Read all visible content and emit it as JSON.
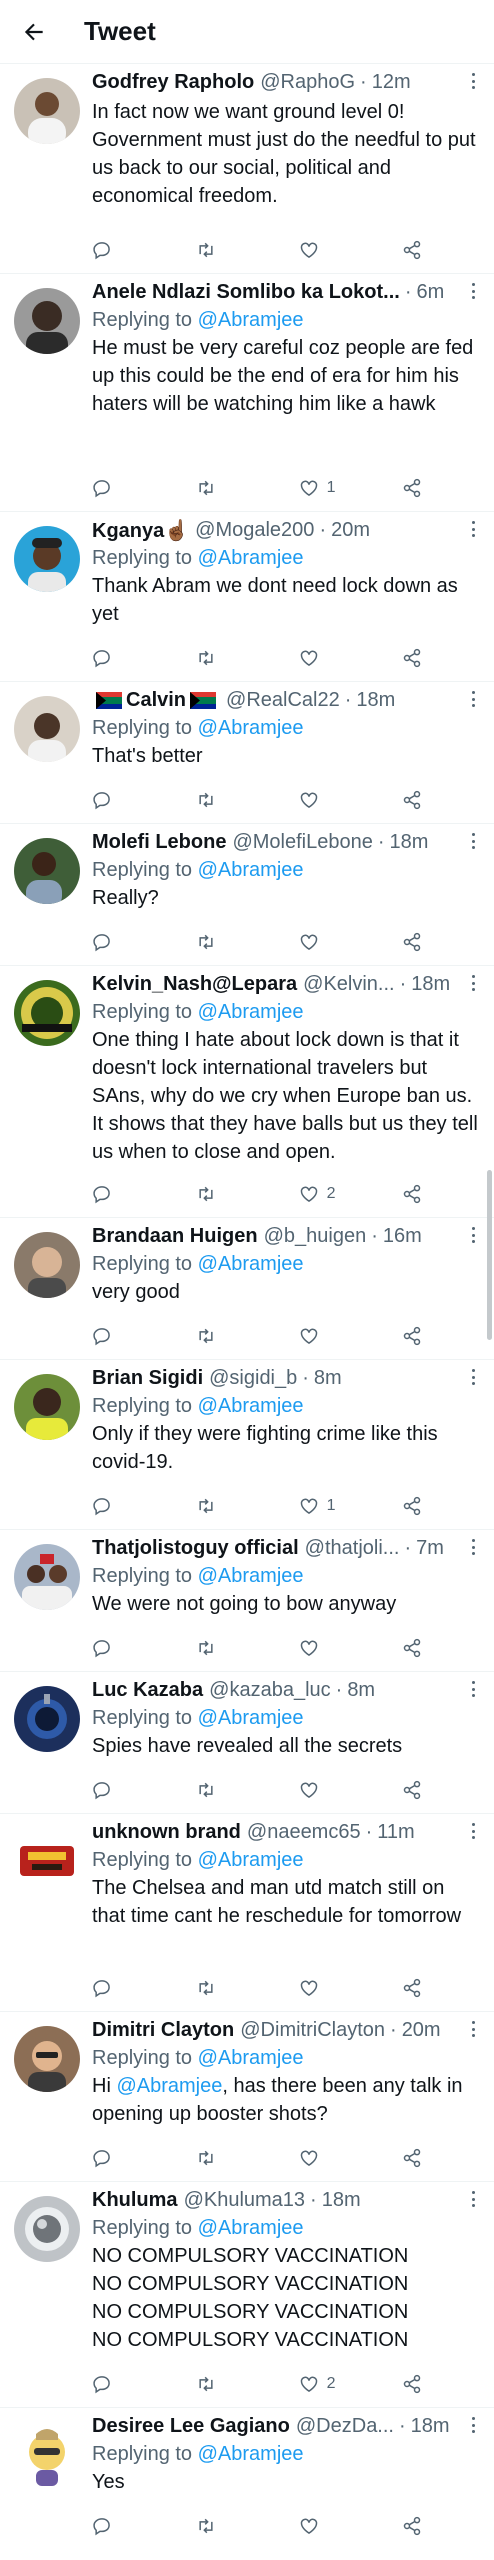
{
  "header": {
    "title": "Tweet"
  },
  "replying_label": "Replying to",
  "tweets": [
    {
      "name": "Godfrey Rapholo",
      "handle": "@RaphoG",
      "time": "12m",
      "replying_to": "@Abramjee",
      "text": "In fact now we want ground level 0! Government must just do the needful to put us back to our social, political and economical freedom.",
      "likes": "",
      "avatar_color": "#c9c1b6"
    },
    {
      "name": "Anele Ndlazi Somlibo ka Lokot...",
      "handle": "",
      "time": "6m",
      "replying_to": "@Abramjee",
      "text": "He must be very careful coz people are fed up this could be the end of era for him his haters will be watching him like a hawk",
      "likes": "1",
      "avatar_color": "#4a4a4a"
    },
    {
      "name": "Kganya☝🏾",
      "handle": "@Mogale200",
      "time": "20m",
      "replying_to": "@Abramjee",
      "text": "Thank Abram we dont need lock down as yet",
      "likes": "",
      "avatar_color": "#2aa3d8"
    },
    {
      "name": "Calvin",
      "handle": "@RealCal22",
      "time": "18m",
      "replying_to": "@Abramjee",
      "text": "That's better",
      "likes": "",
      "avatar_color": "#d9d2c8"
    },
    {
      "name": "Molefi Lebone",
      "handle": "@MolefiLebone",
      "time": "18m",
      "replying_to": "@Abramjee",
      "text": "Really?",
      "likes": "",
      "avatar_color": "#3f5e38"
    },
    {
      "name": "Kelvin_Nash@Lepara",
      "handle": "@Kelvin...",
      "time": "18m",
      "replying_to": "@Abramjee",
      "text": "One thing I hate about lock down is that it doesn't lock international travelers but SAns, why do we cry when Europe ban us. It shows that they have balls but us they tell us when to close and open.",
      "likes": "2",
      "avatar_color": "#3b6b1e"
    },
    {
      "name": "Brandaan Huigen",
      "handle": "@b_huigen",
      "time": "16m",
      "replying_to": "@Abramjee",
      "text": "very good",
      "likes": "",
      "avatar_color": "#8a7a6a"
    },
    {
      "name": "Brian Sigidi",
      "handle": "@sigidi_b",
      "time": "8m",
      "replying_to": "@Abramjee",
      "text": "Only if they were fighting crime like this covid-19.",
      "likes": "1",
      "avatar_color": "#6d8f3a"
    },
    {
      "name": "Thatjolistoguy official",
      "handle": "@thatjoli...",
      "time": "7m",
      "replying_to": "@Abramjee",
      "text": "We were not going to bow anyway",
      "likes": "",
      "avatar_color": "#a9b7c9"
    },
    {
      "name": "Luc Kazaba",
      "handle": "@kazaba_luc",
      "time": "8m",
      "replying_to": "@Abramjee",
      "text": "Spies have revealed all the secrets",
      "likes": "",
      "avatar_color": "#1c2f5c"
    },
    {
      "name": "unknown brand",
      "handle": "@naeemc65",
      "time": "11m",
      "replying_to": "@Abramjee",
      "text": "The Chelsea and man utd match still on that time cant he reschedule for tomorrow",
      "likes": "",
      "avatar_color": "#b8221c"
    },
    {
      "name": "Dimitri Clayton",
      "handle": "@DimitriClayton",
      "time": "20m",
      "replying_to": "@Abramjee",
      "text_pre": "Hi ",
      "text_mention": "@Abramjee",
      "text": ", has there been any talk in opening up booster shots?",
      "likes": "",
      "avatar_color": "#8c6e55"
    },
    {
      "name": "Khuluma",
      "handle": "@Khuluma13",
      "time": "18m",
      "replying_to": "@Abramjee",
      "text": "NO COMPULSORY VACCINATION NO COMPULSORY VACCINATION NO COMPULSORY VACCINATION NO COMPULSORY VACCINATION",
      "likes": "2",
      "avatar_color": "#bfc3c7"
    },
    {
      "name": "Desiree Lee Gagiano",
      "handle": "@DezDa...",
      "time": "18m",
      "replying_to": "@Abramjee",
      "text": "Yes",
      "likes": "",
      "avatar_color": "#f3d36b"
    }
  ],
  "colors": {
    "accent": "#1d9bf0",
    "muted": "#536471",
    "text": "#0f1419",
    "divider": "#eff3f4"
  }
}
